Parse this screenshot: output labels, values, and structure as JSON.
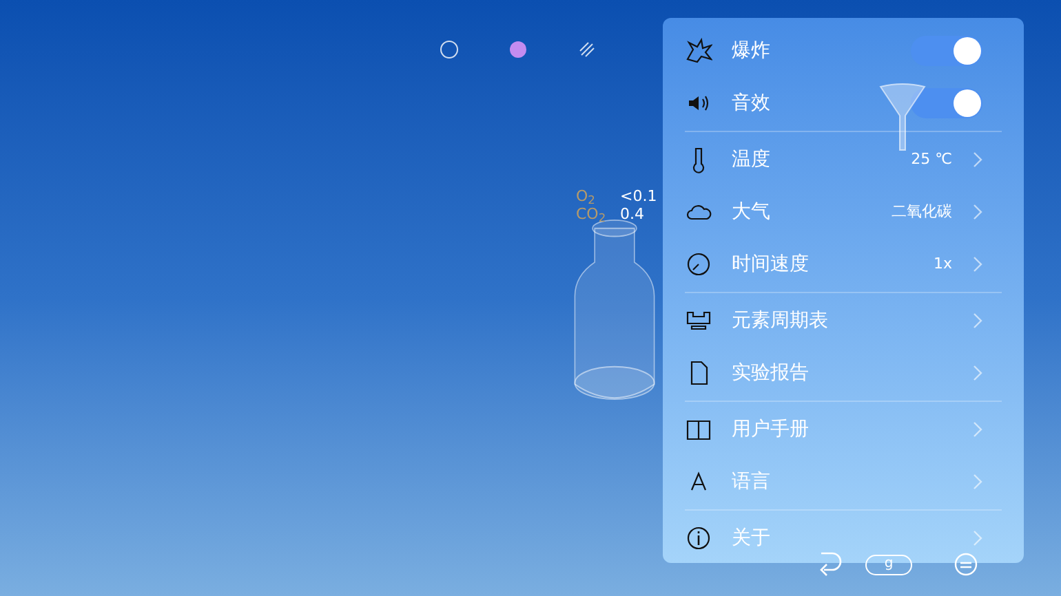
{
  "toolbar": {
    "modes": [
      {
        "selected": false
      },
      {
        "selected": true
      },
      {
        "selected": false
      }
    ]
  },
  "gas_readings": [
    {
      "label": "O$_{2}$",
      "value": "<0.1"
    },
    {
      "label": "CO$_{2}$",
      "value": "0.4"
    }
  ],
  "menu": {
    "sections": [
      [
        {
          "kind": "toggle",
          "label": "爆炸",
          "on": true
        },
        {
          "kind": "toggle",
          "label": "音效",
          "on": true
        }
      ],
      [
        {
          "kind": "link",
          "label": "温度",
          "value": "25 ℃"
        },
        {
          "kind": "link",
          "label": "大气",
          "value": "二氧化碳"
        },
        {
          "kind": "link",
          "label": "时间速度",
          "value": "1x"
        }
      ],
      [
        {
          "kind": "link",
          "label": "元素周期表"
        },
        {
          "kind": "link",
          "label": "实验报告"
        }
      ],
      [
        {
          "kind": "link",
          "label": "用户手册"
        },
        {
          "kind": "link",
          "label": "语言"
        }
      ],
      [
        {
          "kind": "link",
          "label": "关于"
        }
      ]
    ]
  },
  "bottom_bar": {
    "weight_label": "g"
  }
}
